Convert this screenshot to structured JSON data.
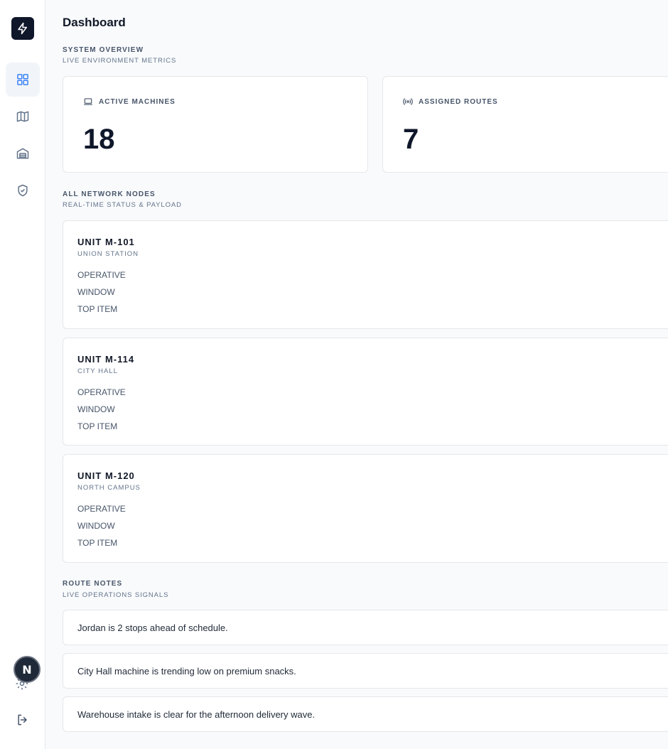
{
  "header": {
    "title": "Dashboard"
  },
  "overview": {
    "title": "SYSTEM OVERVIEW",
    "subtitle": "LIVE ENVIRONMENT METRICS",
    "metrics": [
      {
        "label": "ACTIVE MACHINES",
        "value": "18",
        "icon": "laptop-icon"
      },
      {
        "label": "ASSIGNED ROUTES",
        "value": "7",
        "icon": "broadcast-icon"
      }
    ]
  },
  "nodes": {
    "title": "ALL NETWORK NODES",
    "subtitle": "REAL-TIME STATUS & PAYLOAD",
    "items": [
      {
        "name": "UNIT M-101",
        "location": "UNION STATION",
        "status": "OPERATIVE",
        "window": "WINDOW",
        "top_item": "TOP ITEM"
      },
      {
        "name": "UNIT M-114",
        "location": "CITY HALL",
        "status": "OPERATIVE",
        "window": "WINDOW",
        "top_item": "TOP ITEM"
      },
      {
        "name": "UNIT M-120",
        "location": "NORTH CAMPUS",
        "status": "OPERATIVE",
        "window": "WINDOW",
        "top_item": "TOP ITEM"
      }
    ]
  },
  "notes": {
    "title": "ROUTE NOTES",
    "subtitle": "LIVE OPERATIONS SIGNALS",
    "items": [
      "Jordan is 2 stops ahead of schedule.",
      "City Hall machine is trending low on premium snacks.",
      "Warehouse intake is clear for the afternoon delivery wave."
    ]
  },
  "sidebar": {
    "items": [
      {
        "icon": "grid-icon",
        "active": true
      },
      {
        "icon": "map-icon",
        "active": false
      },
      {
        "icon": "warehouse-icon",
        "active": false
      },
      {
        "icon": "shield-check-icon",
        "active": false
      }
    ],
    "avatar_initial": "N"
  },
  "colors": {
    "accent": "#3b82f6",
    "brand": "#0f172a"
  }
}
